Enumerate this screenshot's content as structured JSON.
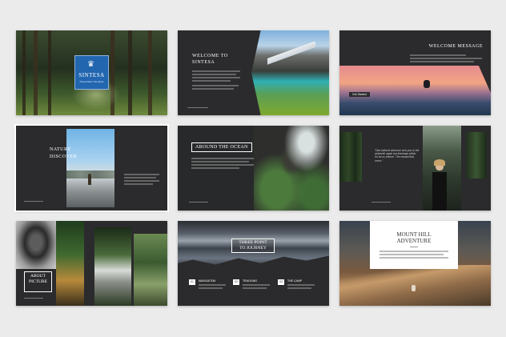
{
  "slides": {
    "cover": {
      "title": "SINTESA",
      "subtitle": "Presentation Template"
    },
    "welcome": {
      "title_line1": "WELCOME TO",
      "title_line2": "SINTESA"
    },
    "welcome_message": {
      "title": "WELCOME MESSAGE",
      "button": "Get Started"
    },
    "nature": {
      "title_line1": "NATURE",
      "title_line2": "DISCOVER"
    },
    "ocean": {
      "title": "AROUND THE OCEAN"
    },
    "quote": {
      "quote": "\"Dan tailored welcome sent you to the sixteenth again but learnings within. So let us endure. The reward that come.\""
    },
    "about": {
      "title_line1": "ABOUT",
      "title_line2": "PICTURE"
    },
    "journey": {
      "title_line1": "THREE POINT",
      "title_line2": "TO JOURNEY",
      "points": [
        {
          "num": "01",
          "label": "NAVIGATION"
        },
        {
          "num": "02",
          "label": "TRACKING"
        },
        {
          "num": "03",
          "label": "THE CAMP"
        }
      ]
    },
    "mount": {
      "title_line1": "MOUNT HILL",
      "title_line2": "ADVENTURE"
    }
  },
  "colors": {
    "page_bg": "#ebebeb",
    "slide_dark": "#2b2b2d",
    "accent_blue": "#2366b0"
  }
}
